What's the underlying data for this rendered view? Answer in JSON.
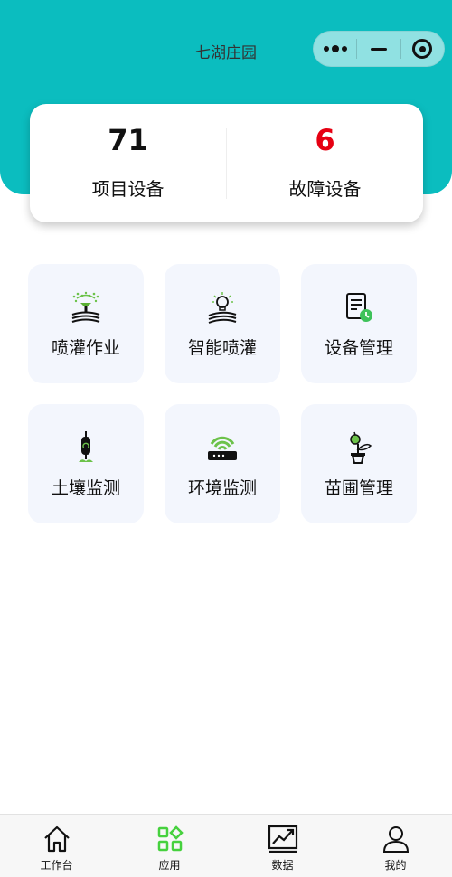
{
  "header": {
    "title": "七湖庄园",
    "capsule": {
      "more_icon": "more-dots-icon",
      "minimize_icon": "minimize-icon",
      "close_icon": "target-close-icon"
    }
  },
  "stats": [
    {
      "value": "71",
      "label": "项目设备",
      "color": "#111111"
    },
    {
      "value": "6",
      "label": "故障设备",
      "color": "#e60012"
    }
  ],
  "apps": [
    {
      "label": "喷灌作业",
      "icon": "sprinkler-field-icon"
    },
    {
      "label": "智能喷灌",
      "icon": "bulb-field-icon"
    },
    {
      "label": "设备管理",
      "icon": "document-clock-icon"
    },
    {
      "label": "土壤监测",
      "icon": "soil-sensor-icon"
    },
    {
      "label": "环境监测",
      "icon": "router-signal-icon"
    },
    {
      "label": "苗圃管理",
      "icon": "seedling-pot-icon"
    }
  ],
  "tabbar": [
    {
      "label": "工作台",
      "icon": "home-icon",
      "active": false
    },
    {
      "label": "应用",
      "icon": "apps-grid-icon",
      "active": true
    },
    {
      "label": "数据",
      "icon": "chart-trend-icon",
      "active": false
    },
    {
      "label": "我的",
      "icon": "user-icon",
      "active": false
    }
  ],
  "colors": {
    "brand": "#0bbdbf",
    "accent_green": "#46d13e",
    "fault_red": "#e60012",
    "tile_bg": "#f3f6fd"
  }
}
